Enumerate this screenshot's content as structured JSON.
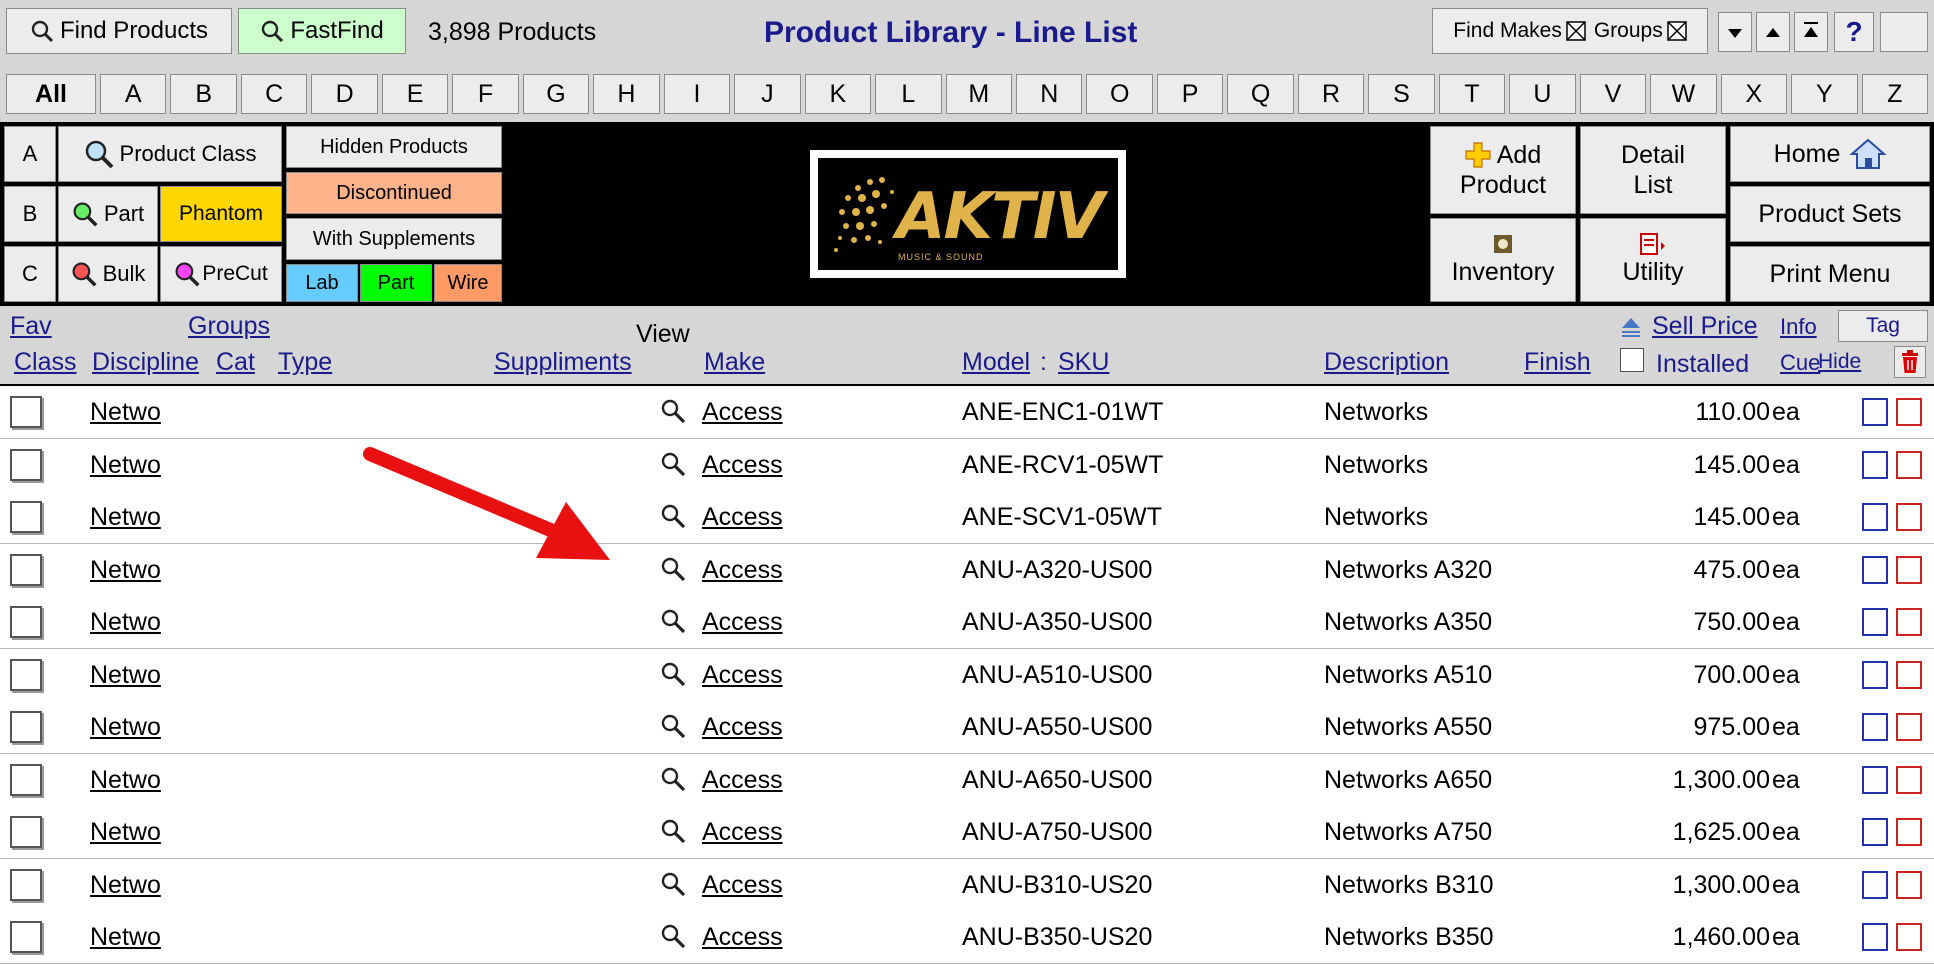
{
  "topbar": {
    "find_products": "Find Products",
    "fastfind": "FastFind",
    "product_count": "3,898 Products",
    "title": "Product Library - Line List",
    "find_makes": "Find Makes",
    "groups": "Groups",
    "help": "?"
  },
  "letters": [
    "All",
    "A",
    "B",
    "C",
    "D",
    "E",
    "F",
    "G",
    "H",
    "I",
    "J",
    "K",
    "L",
    "M",
    "N",
    "O",
    "P",
    "Q",
    "R",
    "S",
    "T",
    "U",
    "V",
    "W",
    "X",
    "Y",
    "Z"
  ],
  "tools": {
    "row_a": "A",
    "row_b": "B",
    "row_c": "C",
    "product_class": "Product Class",
    "part": "Part",
    "phantom": "Phantom",
    "bulk": "Bulk",
    "precut": "PreCut",
    "hidden_products": "Hidden Products",
    "discontinued": "Discontinued",
    "with_supplements": "With Supplements",
    "lab": "Lab",
    "part_filter": "Part",
    "wire": "Wire",
    "logo_text": "AKTIV",
    "logo_sub": "MUSIC & SOUND",
    "add_product": [
      "Add",
      "Product"
    ],
    "detail_list": [
      "Detail",
      "List"
    ],
    "home": "Home",
    "product_sets": "Product Sets",
    "inventory": "Inventory",
    "utility": "Utility",
    "print_menu": "Print Menu"
  },
  "columns": {
    "fav": "Fav",
    "groups": "Groups",
    "view": "View",
    "class": "Class",
    "discipline": "Discipline",
    "cat": "Cat",
    "type": "Type",
    "supplements": "Suppliments",
    "make": "Make",
    "model": "Model",
    "sep": ":",
    "sku": "SKU",
    "description": "Description",
    "finish": "Finish",
    "sell_price": "Sell Price",
    "installed": "Installed",
    "info": "Info",
    "cue": "Cue",
    "tag": "Tag",
    "hide": "Hide"
  },
  "rows": [
    {
      "discipline": "Netwo",
      "make": "Access",
      "model": "ANE-ENC1-01WT",
      "description": "Networks",
      "price": "110.00",
      "unit": "ea"
    },
    {
      "discipline": "Netwo",
      "make": "Access",
      "model": "ANE-RCV1-05WT",
      "description": "Networks",
      "price": "145.00",
      "unit": "ea"
    },
    {
      "discipline": "Netwo",
      "make": "Access",
      "model": "ANE-SCV1-05WT",
      "description": "Networks",
      "price": "145.00",
      "unit": "ea"
    },
    {
      "discipline": "Netwo",
      "make": "Access",
      "model": "ANU-A320-US00",
      "description": "Networks A320",
      "price": "475.00",
      "unit": "ea"
    },
    {
      "discipline": "Netwo",
      "make": "Access",
      "model": "ANU-A350-US00",
      "description": "Networks A350",
      "price": "750.00",
      "unit": "ea"
    },
    {
      "discipline": "Netwo",
      "make": "Access",
      "model": "ANU-A510-US00",
      "description": "Networks A510",
      "price": "700.00",
      "unit": "ea"
    },
    {
      "discipline": "Netwo",
      "make": "Access",
      "model": "ANU-A550-US00",
      "description": "Networks A550",
      "price": "975.00",
      "unit": "ea"
    },
    {
      "discipline": "Netwo",
      "make": "Access",
      "model": "ANU-A650-US00",
      "description": "Networks A650",
      "price": "1,300.00",
      "unit": "ea"
    },
    {
      "discipline": "Netwo",
      "make": "Access",
      "model": "ANU-A750-US00",
      "description": "Networks A750",
      "price": "1,625.00",
      "unit": "ea"
    },
    {
      "discipline": "Netwo",
      "make": "Access",
      "model": "ANU-B310-US20",
      "description": "Networks B310",
      "price": "1,300.00",
      "unit": "ea"
    },
    {
      "discipline": "Netwo",
      "make": "Access",
      "model": "ANU-B350-US20",
      "description": "Networks B350",
      "price": "1,460.00",
      "unit": "ea"
    }
  ],
  "colors": {
    "link": "#1a1a8c",
    "phantom": "#ffd700",
    "discontinued": "#ffb38a",
    "lab": "#66ccff",
    "part": "#00ff00",
    "wire": "#ff9966",
    "fastfind": "#ccffcc",
    "annotation_arrow": "#e81010"
  },
  "icons": {
    "search": "magnifier-icon",
    "home": "house-icon",
    "add": "plus-icon",
    "inventory": "gear-icon",
    "utility": "export-icon",
    "trash": "trash-icon"
  }
}
